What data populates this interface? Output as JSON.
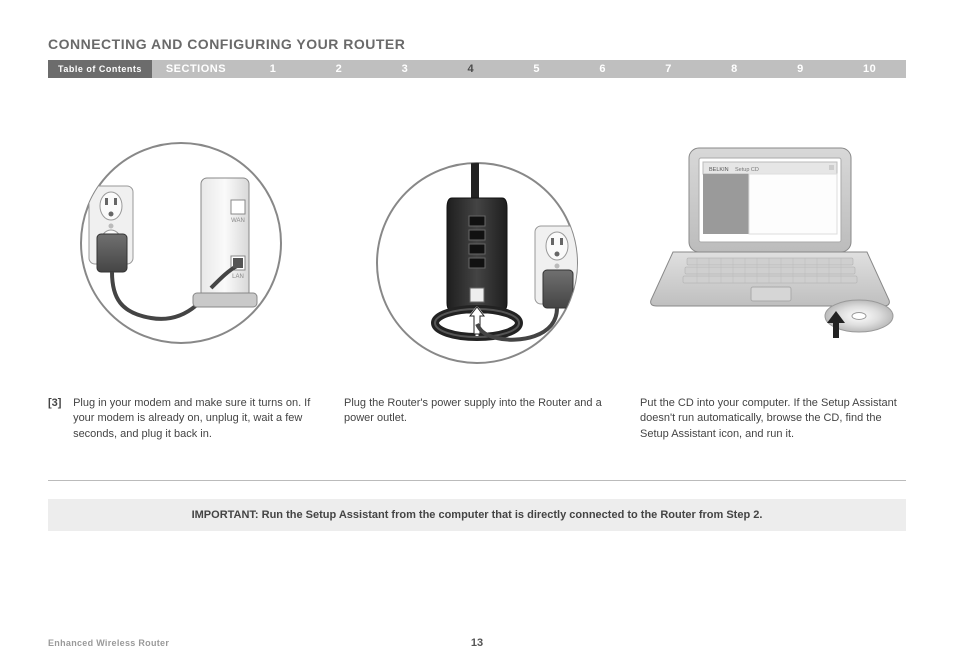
{
  "heading": "CONNECTING AND CONFIGURING YOUR ROUTER",
  "nav": {
    "toc": "Table of Contents",
    "sections_label": "SECTIONS",
    "items": [
      "1",
      "2",
      "3",
      "4",
      "5",
      "6",
      "7",
      "8",
      "9",
      "10"
    ],
    "active_index": 3
  },
  "laptop_screen": {
    "brand": "BELKIN",
    "window_title": "Setup CD"
  },
  "captions": [
    {
      "num": "[3]",
      "text": "Plug in your modem and make sure it turns on. If your modem is already on, unplug it, wait a few seconds, and plug it back in."
    },
    {
      "num": "",
      "text": "Plug the Router's power supply into the Router and a power outlet."
    },
    {
      "num": "",
      "text": "Put the CD into your computer. If the Setup Assistant doesn't run automatically, browse the CD, find the Setup Assistant icon, and run it."
    }
  ],
  "important": "IMPORTANT: Run the Setup Assistant from the computer that is directly connected to the Router from Step 2.",
  "footer": {
    "left": "Enhanced Wireless Router",
    "page": "13"
  }
}
